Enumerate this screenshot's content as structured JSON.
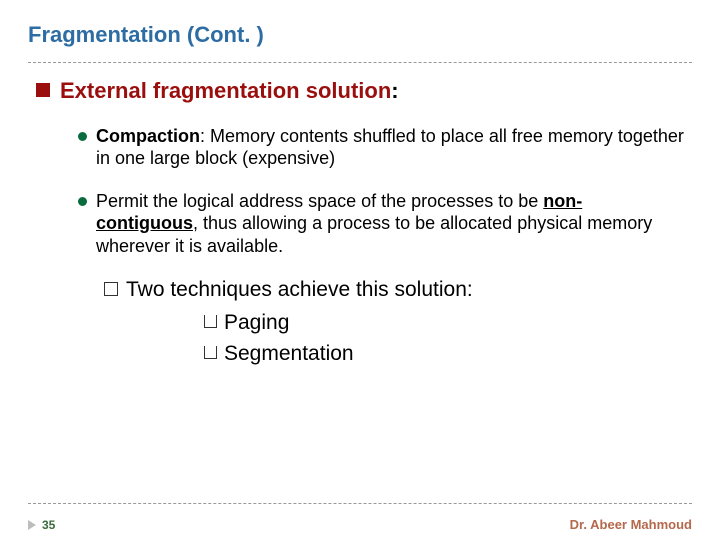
{
  "title": "Fragmentation (Cont. )",
  "heading": "External fragmentation solution",
  "colon": ":",
  "bullets": {
    "b1_strong": "Compaction",
    "b1_rest": ": Memory contents shuffled to place all free memory together in one large block (expensive)",
    "b2_pre": "Permit the logical address space of the processes to be ",
    "b2_under": "non-contiguous",
    "b2_post": ", thus allowing a process to be allocated physical memory wherever it is available."
  },
  "inner": {
    "two": "Two techniques achieve this solution:",
    "paging": "Paging",
    "segmentation": "Segmentation"
  },
  "footer": {
    "page": "35",
    "author": "Dr. Abeer Mahmoud"
  }
}
